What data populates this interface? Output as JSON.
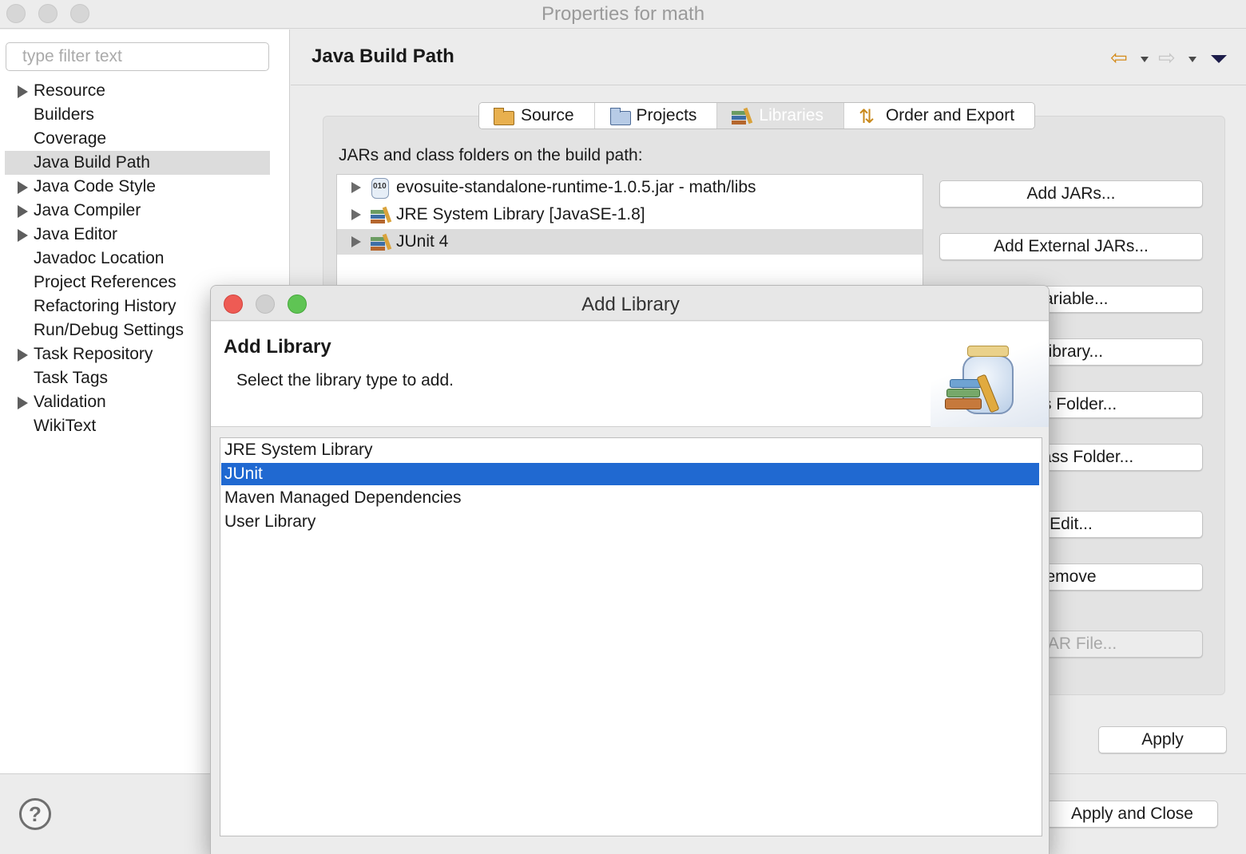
{
  "window": {
    "title": "Properties for math"
  },
  "filter": {
    "placeholder": "type filter text"
  },
  "nav_tree": [
    {
      "label": "Resource",
      "expandable": true
    },
    {
      "label": "Builders",
      "expandable": false
    },
    {
      "label": "Coverage",
      "expandable": false
    },
    {
      "label": "Java Build Path",
      "expandable": false,
      "selected": true
    },
    {
      "label": "Java Code Style",
      "expandable": true
    },
    {
      "label": "Java Compiler",
      "expandable": true
    },
    {
      "label": "Java Editor",
      "expandable": true
    },
    {
      "label": "Javadoc Location",
      "expandable": false
    },
    {
      "label": "Project References",
      "expandable": false
    },
    {
      "label": "Refactoring History",
      "expandable": false
    },
    {
      "label": "Run/Debug Settings",
      "expandable": false
    },
    {
      "label": "Task Repository",
      "expandable": true
    },
    {
      "label": "Task Tags",
      "expandable": false
    },
    {
      "label": "Validation",
      "expandable": true
    },
    {
      "label": "WikiText",
      "expandable": false
    }
  ],
  "page": {
    "title": "Java Build Path",
    "nav_back_icon": "⇦",
    "nav_forward_icon": "⇨",
    "tabs": [
      {
        "label": "Source",
        "icon": "source-folder-icon"
      },
      {
        "label": "Projects",
        "icon": "projects-icon"
      },
      {
        "label": "Libraries",
        "icon": "libraries-icon",
        "active": true
      },
      {
        "label": "Order and Export",
        "icon": "order-export-icon"
      }
    ],
    "build_path_label": "JARs and class folders on the build path:",
    "jar_entries": [
      {
        "label": "evosuite-standalone-runtime-1.0.5.jar - math/libs",
        "icon": "jar-icon"
      },
      {
        "label": "JRE System Library [JavaSE-1.8]",
        "icon": "library-icon"
      },
      {
        "label": "JUnit 4",
        "icon": "library-icon",
        "selected": true
      }
    ],
    "side_buttons": [
      {
        "label": "Add JARs...",
        "enabled": true
      },
      {
        "label": "Add External JARs...",
        "enabled": true
      },
      {
        "label": "Variable...",
        "enabled": true
      },
      {
        "label": "Library...",
        "enabled": true
      },
      {
        "label": "ass Folder...",
        "enabled": true
      },
      {
        "label": "al Class Folder...",
        "enabled": true
      },
      {
        "label": "Edit...",
        "enabled": true
      },
      {
        "label": "emove",
        "enabled": true
      },
      {
        "label": "e JAR File...",
        "enabled": false
      }
    ],
    "apply_label": "Apply"
  },
  "footer": {
    "help_icon": "?",
    "apply_close_label": "Apply and Close"
  },
  "dialog": {
    "title": "Add Library",
    "heading": "Add Library",
    "description": "Select the library type to add.",
    "library_types": [
      {
        "label": "JRE System Library"
      },
      {
        "label": "JUnit",
        "selected": true
      },
      {
        "label": "Maven Managed Dependencies"
      },
      {
        "label": "User Library"
      }
    ],
    "close_color": "#ee5b54",
    "minimize_color": "#d0d0d0",
    "zoom_color": "#5fc454",
    "selection_color": "#2069d1"
  }
}
